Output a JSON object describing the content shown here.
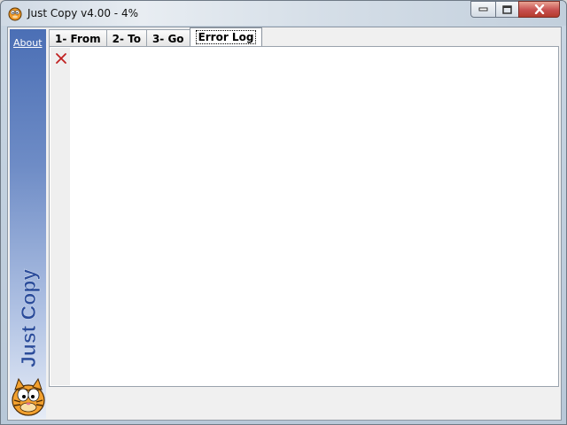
{
  "window": {
    "title": "Just Copy v4.00 - 4%",
    "icon": "garfield-icon"
  },
  "title_buttons": {
    "minimize": "minimize-icon",
    "maximize": "maximize-icon",
    "close": "close-icon"
  },
  "sidebar": {
    "about_label": "About",
    "brand_text": "Just Copy",
    "mascot": "garfield-mascot"
  },
  "tabs": [
    {
      "label": "1- From",
      "active": false
    },
    {
      "label": "2- To",
      "active": false
    },
    {
      "label": "3- Go",
      "active": false
    },
    {
      "label": "Error Log",
      "active": true
    }
  ],
  "error_log": {
    "clear_icon": "red-x-icon",
    "entries": []
  },
  "colors": {
    "sidebar_top": "#4b6fb5",
    "brand_text": "#2b4c9a",
    "clear_icon": "#c02020",
    "close_button": "#c75050"
  }
}
